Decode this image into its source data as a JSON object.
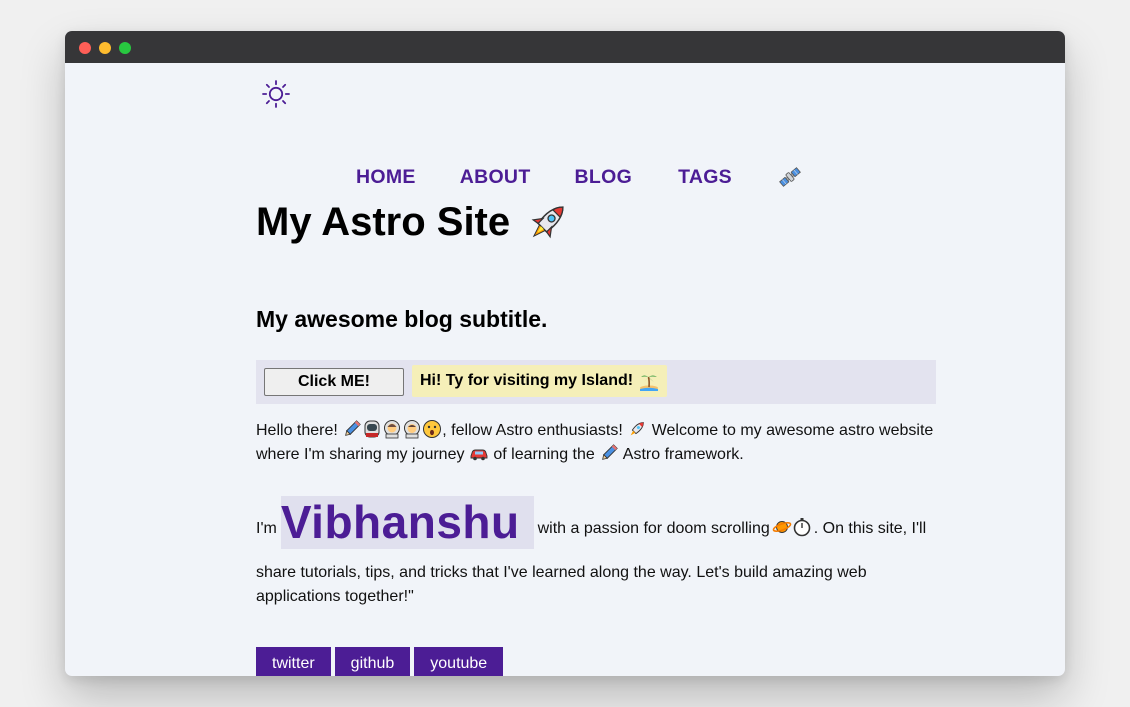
{
  "theme_toggle": {
    "icon": "sun-icon"
  },
  "nav": {
    "home": "HOME",
    "about": "ABOUT",
    "blog": "BLOG",
    "tags": "TAGS",
    "extra_icon": "satellite-icon"
  },
  "header": {
    "title": "My Astro Site",
    "title_icon": "rocket-icon",
    "subtitle": "My awesome blog subtitle."
  },
  "island": {
    "button_label": "Click ME!",
    "greeting": "Hi! Ty for visiting my Island!",
    "greeting_icon": "island-icon"
  },
  "intro": {
    "part1": "Hello there!",
    "part2": ", fellow Astro enthusiasts!",
    "part3": "Welcome to my awesome astro website where I'm sharing my journey",
    "part4": "of learning the",
    "part5": "Astro framework."
  },
  "about": {
    "prefix": "I'm",
    "name": "Vibhanshu",
    "after_name": "with a passion for doom scrolling",
    "after_emoji": ". On this site, I'll",
    "rest": "share tutorials, tips, and tricks that I've learned along the way. Let's build amazing web applications together!\""
  },
  "socials": [
    "twitter",
    "github",
    "youtube"
  ],
  "colors": {
    "accent": "#4c1d95",
    "island_bg": "#e3e3ef",
    "greeting_bg": "#f5efb8",
    "page_bg": "#f1f4f9"
  }
}
